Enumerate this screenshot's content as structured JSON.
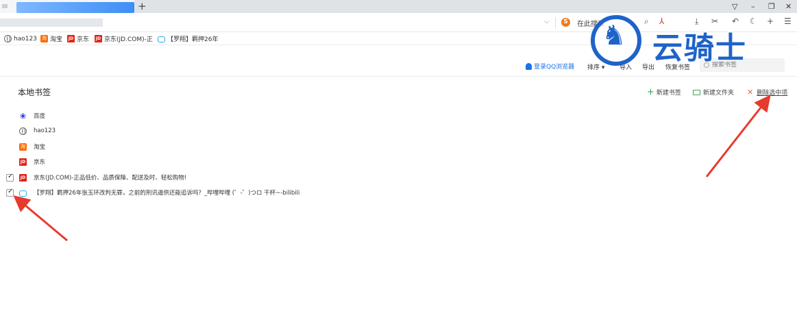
{
  "browser": {
    "new_tab_symbol": "+",
    "window_controls": [
      "▽",
      "–",
      "❐",
      "✕"
    ],
    "search_hint": "在此搜索",
    "toolbar_icons": [
      "search-icon",
      "pdf-icon",
      "download-icon",
      "scissors-icon",
      "undo-icon",
      "moon-icon",
      "plus-icon",
      "menu-icon"
    ]
  },
  "bookmark_bar": [
    {
      "icon": "globe-icon",
      "label": "hao123"
    },
    {
      "icon": "taobao-icon",
      "label": "淘宝"
    },
    {
      "icon": "jd-icon",
      "label": "京东"
    },
    {
      "icon": "jd-icon",
      "label": "京东(JD.COM)-正"
    },
    {
      "icon": "bilibili-icon",
      "label": "【罗翔】羁押26年"
    }
  ],
  "page_toolbar": {
    "login": "登录QQ浏览器",
    "sort": "排序",
    "import": "导入",
    "export": "导出",
    "restore": "恢复书签",
    "search_placeholder": "搜索书签"
  },
  "main": {
    "title": "本地书签",
    "actions": {
      "new_bookmark": "新建书签",
      "new_folder": "新建文件夹",
      "delete_selected": "删除选中项"
    },
    "bookmarks": [
      {
        "icon": "baidu-icon",
        "label": "百度",
        "checked": false
      },
      {
        "icon": "globe-icon",
        "label": "hao123",
        "checked": false
      },
      {
        "icon": "taobao-icon",
        "label": "淘宝",
        "checked": false
      },
      {
        "icon": "jd-icon",
        "label": "京东",
        "checked": false
      },
      {
        "icon": "jd-icon",
        "label": "京东(JD.COM)-正品低价、品质保障、配送及时、轻松购物!",
        "checked": true
      },
      {
        "icon": "bilibili-icon",
        "label": "【罗翔】羁押26年张玉环改判无罪，之前的刑讯逼供还能追诉吗？_哔哩哔哩 (゜-゜)つロ 干杯~-bilibili",
        "checked": true
      }
    ]
  },
  "watermark": {
    "text": "云骑士"
  },
  "colors": {
    "accent": "#1a73e8",
    "arrow": "#e8392e",
    "watermark": "#1f63c9"
  }
}
